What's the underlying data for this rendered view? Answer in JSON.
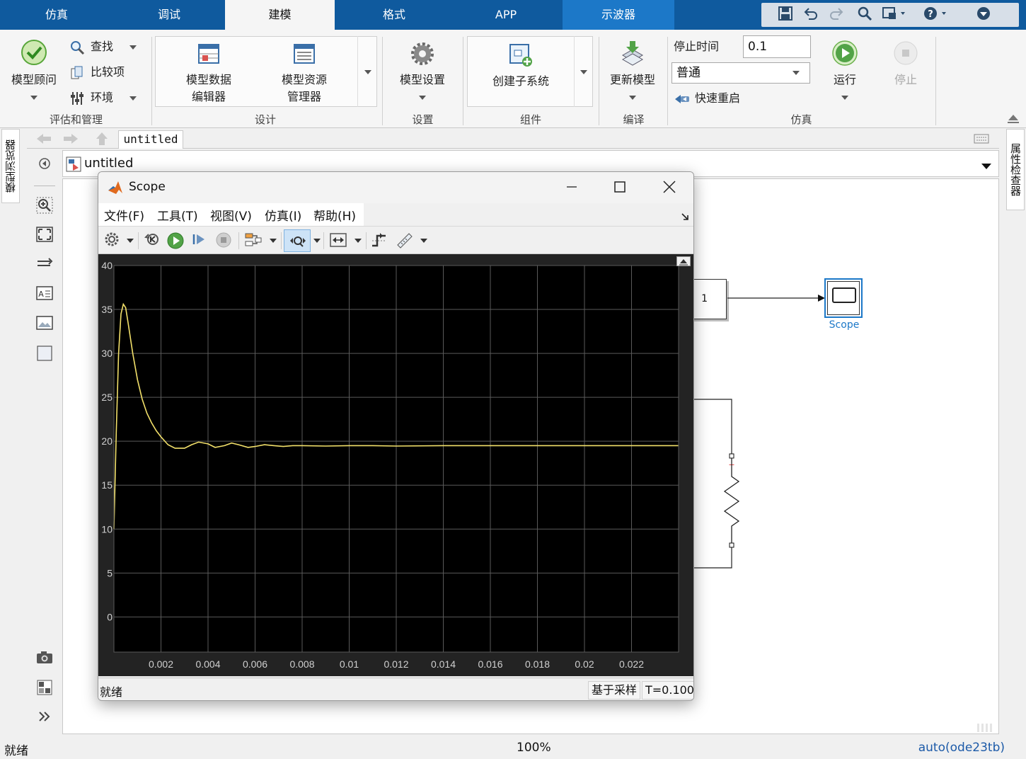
{
  "tabs": [
    {
      "label": "仿真",
      "state": "normal"
    },
    {
      "label": "调试",
      "state": "normal"
    },
    {
      "label": "建模",
      "state": "active"
    },
    {
      "label": "格式",
      "state": "normal"
    },
    {
      "label": "APP",
      "state": "normal"
    },
    {
      "label": "示波器",
      "state": "context"
    }
  ],
  "ribbon": {
    "eval": {
      "model_advisor": "模型顾问",
      "find": "查找",
      "compare": "比较项",
      "environment": "环境",
      "group_label": "评估和管理"
    },
    "design": {
      "data_editor_l1": "模型数据",
      "data_editor_l2": "编辑器",
      "explorer_l1": "模型资源",
      "explorer_l2": "管理器",
      "group_label": "设计"
    },
    "setup": {
      "model_settings": "模型设置",
      "group_label": "设置"
    },
    "component": {
      "create_subsystem": "创建子系统",
      "group_label": "组件"
    },
    "compile": {
      "update_model": "更新模型",
      "group_label": "编译"
    },
    "simulate": {
      "stop_time_label": "停止时间",
      "stop_time_value": "0.1",
      "mode": "普通",
      "fast_restart": "快速重启",
      "run": "运行",
      "stop": "停止",
      "group_label": "仿真"
    }
  },
  "side": {
    "model_browser": "模型浏览器",
    "property_inspector": "属性检查器"
  },
  "editor": {
    "model_tab": "untitled",
    "breadcrumb": "untitled",
    "constant_value": "1",
    "scope_block_label": "Scope"
  },
  "status": {
    "left": "就绪",
    "zoom": "100%",
    "solver": "auto(ode23tb)"
  },
  "scope": {
    "title": "Scope",
    "menu": [
      "文件(F)",
      "工具(T)",
      "视图(V)",
      "仿真(I)",
      "帮助(H)"
    ],
    "status_left": "就绪",
    "status_mode": "基于采样",
    "status_time": "T=0.100"
  },
  "colors": {
    "tabbar": "#0f5a9e",
    "context_tab": "#1c78c8",
    "plot_bg": "#000000",
    "trace": "#f2e06a",
    "grid": "#5a5a5a",
    "selection": "#1c78c8"
  },
  "chart_data": {
    "type": "line",
    "x_ticks": [
      "0.002",
      "0.004",
      "0.006",
      "0.008",
      "0.01",
      "0.012",
      "0.014",
      "0.016",
      "0.018",
      "0.02",
      "0.022"
    ],
    "y_ticks": [
      "0",
      "5",
      "10",
      "15",
      "20",
      "25",
      "30",
      "35",
      "40"
    ],
    "xlim": [
      0,
      0.024
    ],
    "ylim": [
      -4,
      40
    ],
    "grid": true,
    "series": [
      {
        "x": [
          0,
          0.0001,
          0.0002,
          0.0003,
          0.0004,
          0.0005,
          0.0006,
          0.0008,
          0.001,
          0.0012,
          0.0014,
          0.0016,
          0.0018,
          0.002,
          0.0023,
          0.0026,
          0.003,
          0.0033,
          0.0036,
          0.004,
          0.0043,
          0.0047,
          0.005,
          0.0053,
          0.0057,
          0.006,
          0.0064,
          0.0068,
          0.0072,
          0.0076,
          0.008,
          0.009,
          0.01,
          0.011,
          0.012,
          0.014,
          0.016,
          0.018,
          0.02,
          0.022,
          0.024
        ],
        "y": [
          10,
          21,
          30,
          34.5,
          35.6,
          35.2,
          33.5,
          30,
          27,
          24.8,
          23.2,
          22.1,
          21.2,
          20.5,
          19.6,
          19.2,
          19.2,
          19.6,
          19.9,
          19.7,
          19.3,
          19.5,
          19.8,
          19.6,
          19.3,
          19.4,
          19.6,
          19.5,
          19.4,
          19.5,
          19.5,
          19.45,
          19.5,
          19.5,
          19.45,
          19.5,
          19.5,
          19.5,
          19.5,
          19.5,
          19.5
        ]
      }
    ]
  }
}
